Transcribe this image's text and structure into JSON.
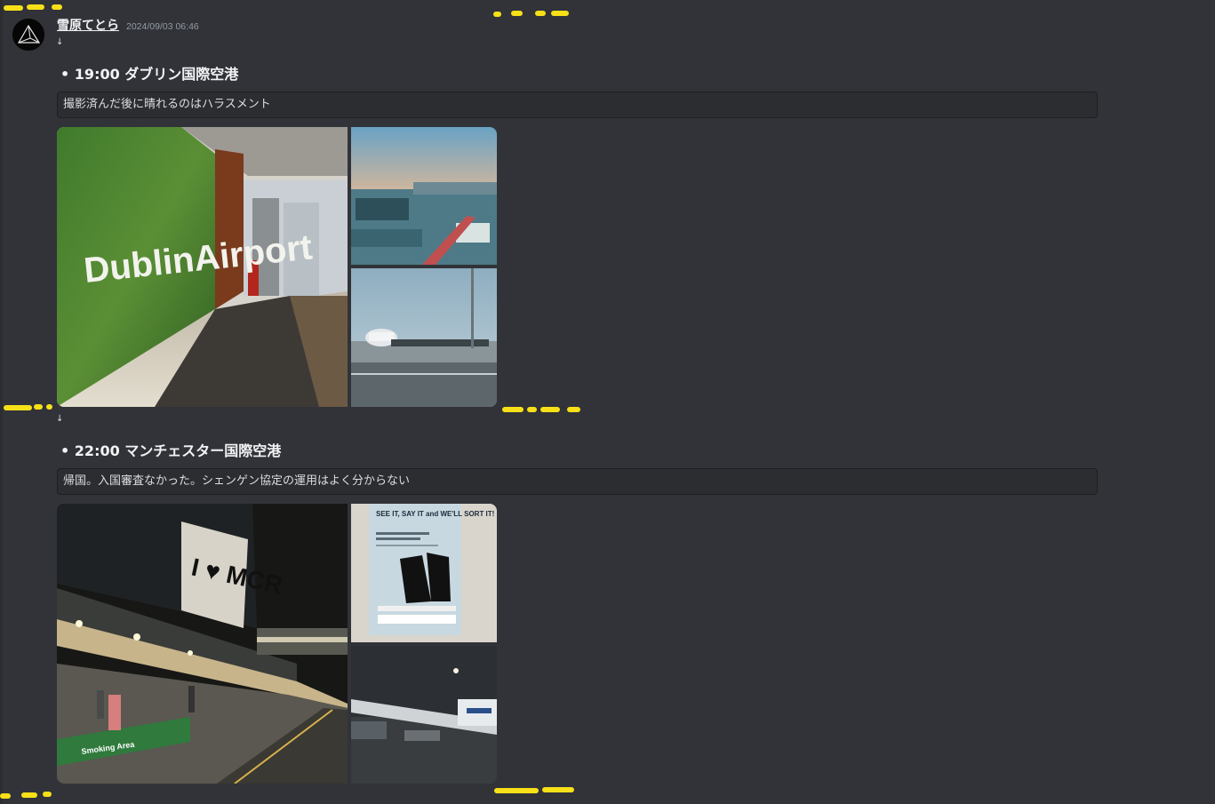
{
  "message": {
    "username": "雪原てとら",
    "timestamp": "2024/09/03 06:46"
  },
  "sections": [
    {
      "arrow": "↓",
      "heading": "• 19:00 ダブリン国際空港",
      "caption": "撮影済んだ後に晴れるのはハラスメント",
      "images": [
        {
          "icon": "photo-dublin-airport-wall",
          "text": "DublinAirport"
        },
        {
          "icon": "photo-apron-sunset"
        },
        {
          "icon": "photo-aircraft-boarding"
        }
      ]
    },
    {
      "arrow": "↓",
      "heading": "• 22:00 マンチェスター国際空港",
      "caption": "帰国。入国審査なかった。シェンゲン協定の運用はよく分からない",
      "images": [
        {
          "icon": "photo-manchester-terminal-night",
          "text": "I ♥ MCR",
          "signs": "Smoking Area"
        },
        {
          "icon": "photo-see-it-say-it-poster",
          "text": "SEE IT, SAY IT and WE'LL SORT IT!"
        },
        {
          "icon": "photo-aircraft-wing-night"
        }
      ]
    }
  ],
  "colors": {
    "background": "#313338",
    "codeblock": "#2b2d31",
    "timestamp": "#949ba4",
    "annotation": "#f7e017"
  }
}
